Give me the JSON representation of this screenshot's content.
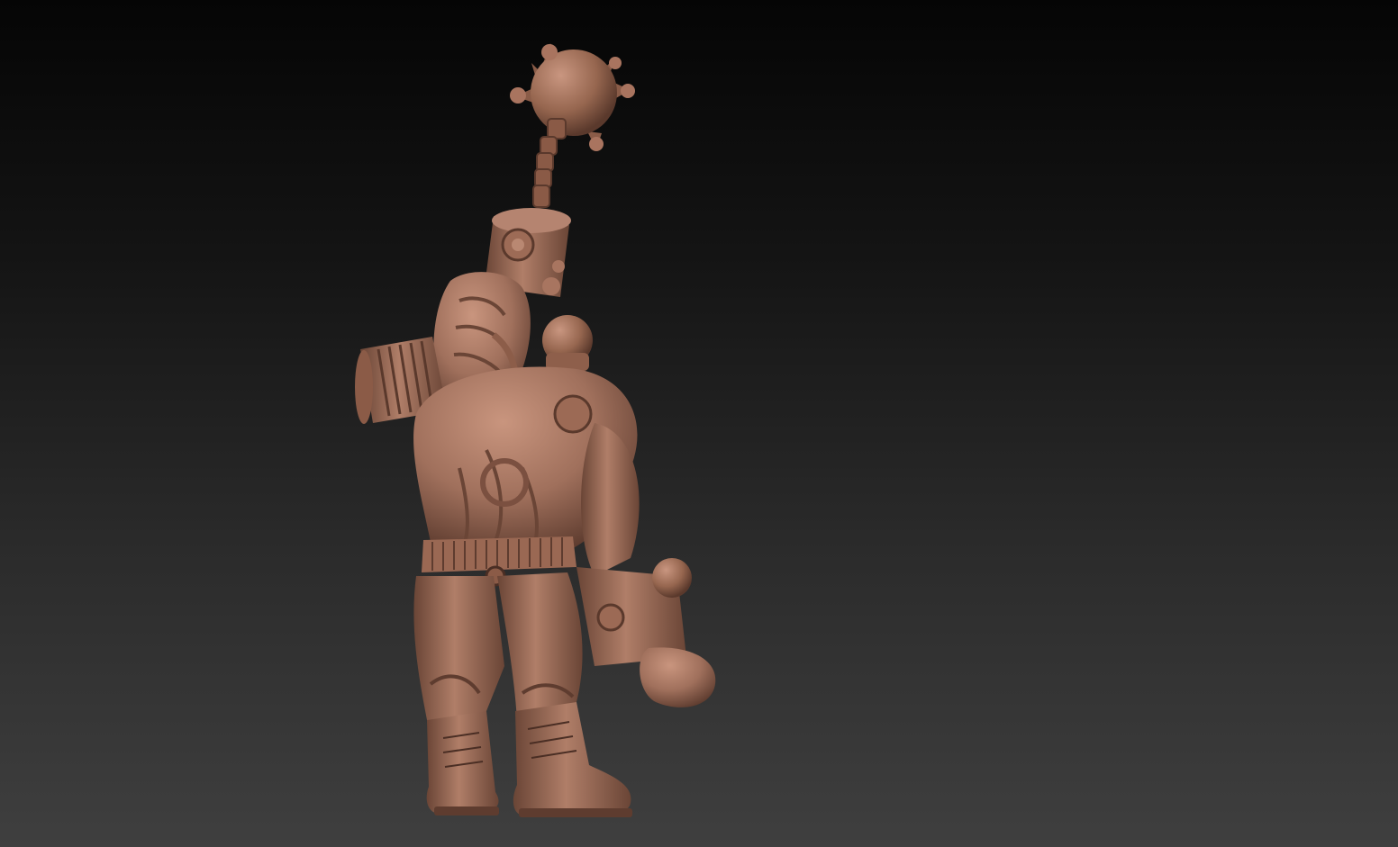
{
  "viewport": {
    "background_top": "#050505",
    "background_bottom": "#3f3f3f"
  },
  "model": {
    "subject": "clay-sculpt-brute-with-flail",
    "material_color": "#a0705c",
    "highlight_color": "#c08c76",
    "shadow_color": "#6a4536",
    "deep_shadow_color": "#4a2e24"
  }
}
